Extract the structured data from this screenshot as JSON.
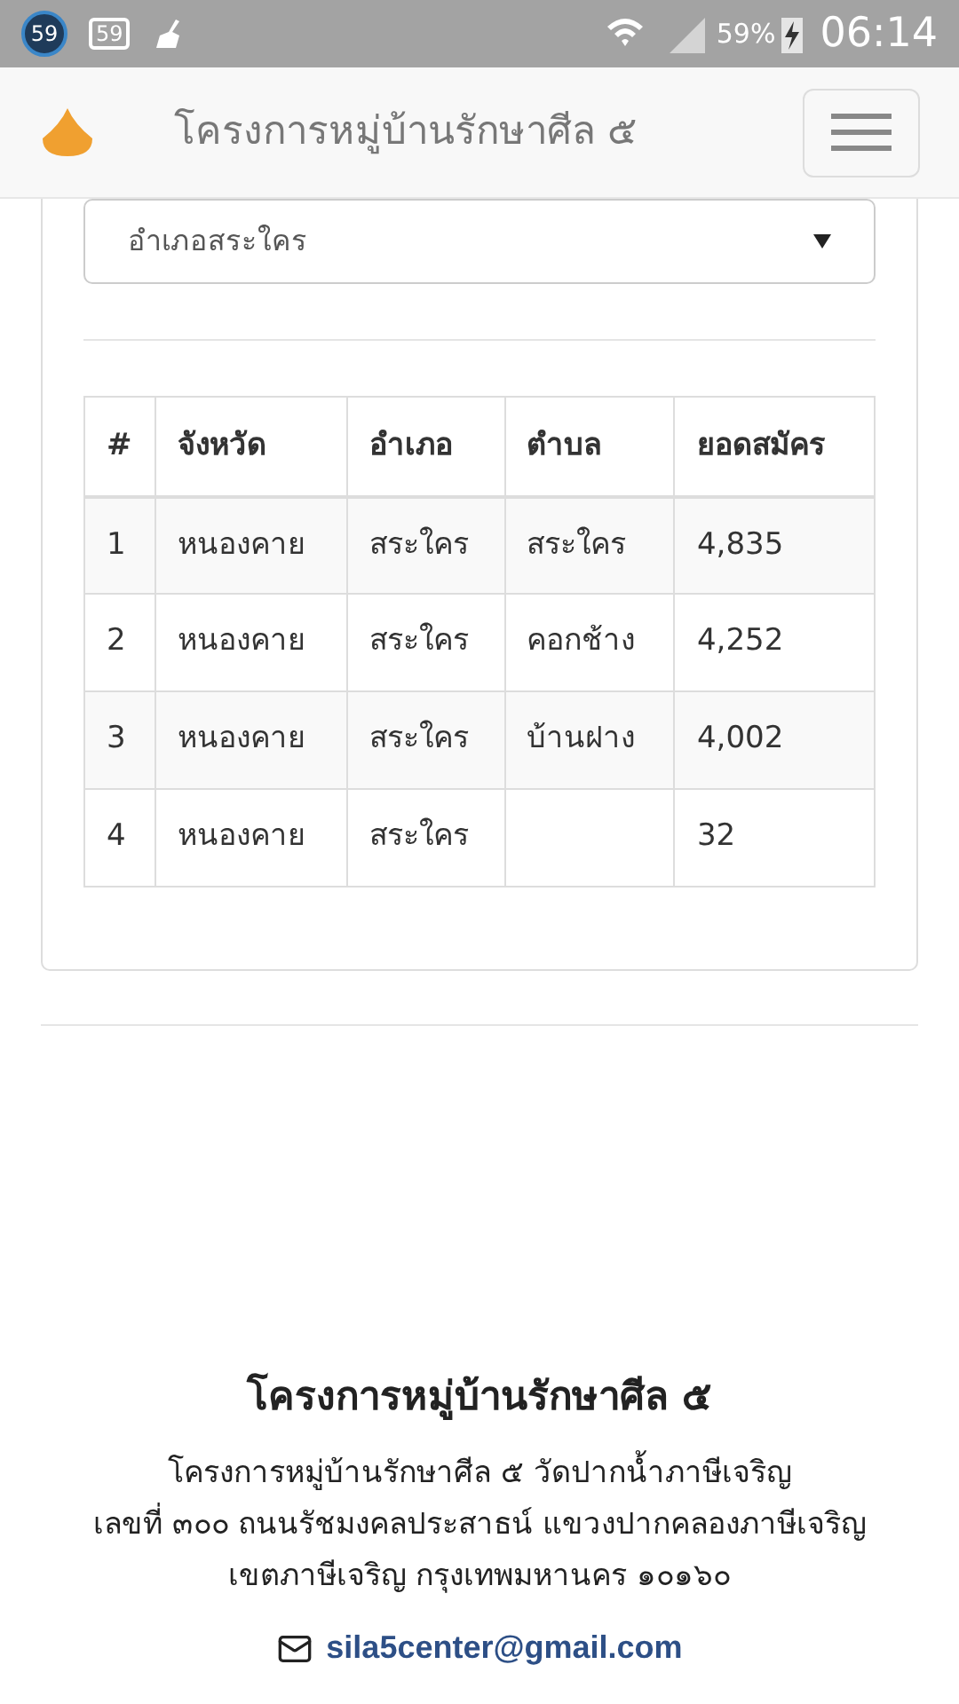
{
  "status_bar": {
    "badge_circle": "59",
    "badge_box": "59",
    "battery_percent": "59%",
    "time": "06:14"
  },
  "navbar": {
    "title": "โครงการหมู่บ้านรักษาศีล ๕"
  },
  "district_select": {
    "value": "อำเภอสระใคร"
  },
  "table": {
    "columns": [
      "#",
      "จังหวัด",
      "อำเภอ",
      "ตำบล",
      "ยอดสมัคร"
    ],
    "rows": [
      [
        "1",
        "หนองคาย",
        "สระใคร",
        "สระใคร",
        "4,835"
      ],
      [
        "2",
        "หนองคาย",
        "สระใคร",
        "คอกช้าง",
        "4,252"
      ],
      [
        "3",
        "หนองคาย",
        "สระใคร",
        "บ้านฝาง",
        "4,002"
      ],
      [
        "4",
        "หนองคาย",
        "สระใคร",
        "",
        "32"
      ]
    ]
  },
  "footer": {
    "title": "โครงการหมู่บ้านรักษาศีล ๕",
    "address_lines": [
      "โครงการหมู่บ้านรักษาศีล ๕ วัดปากน้ำภาษีเจริญ",
      "เลขที่ ๓๐๐ ถนนรัชมงคลประสาธน์ แขวงปากคลองภาษีเจริญ",
      "เขตภาษีเจริญ กรุงเทพมหานคร ๑๐๑๖๐"
    ],
    "email": "sila5center@gmail.com"
  }
}
